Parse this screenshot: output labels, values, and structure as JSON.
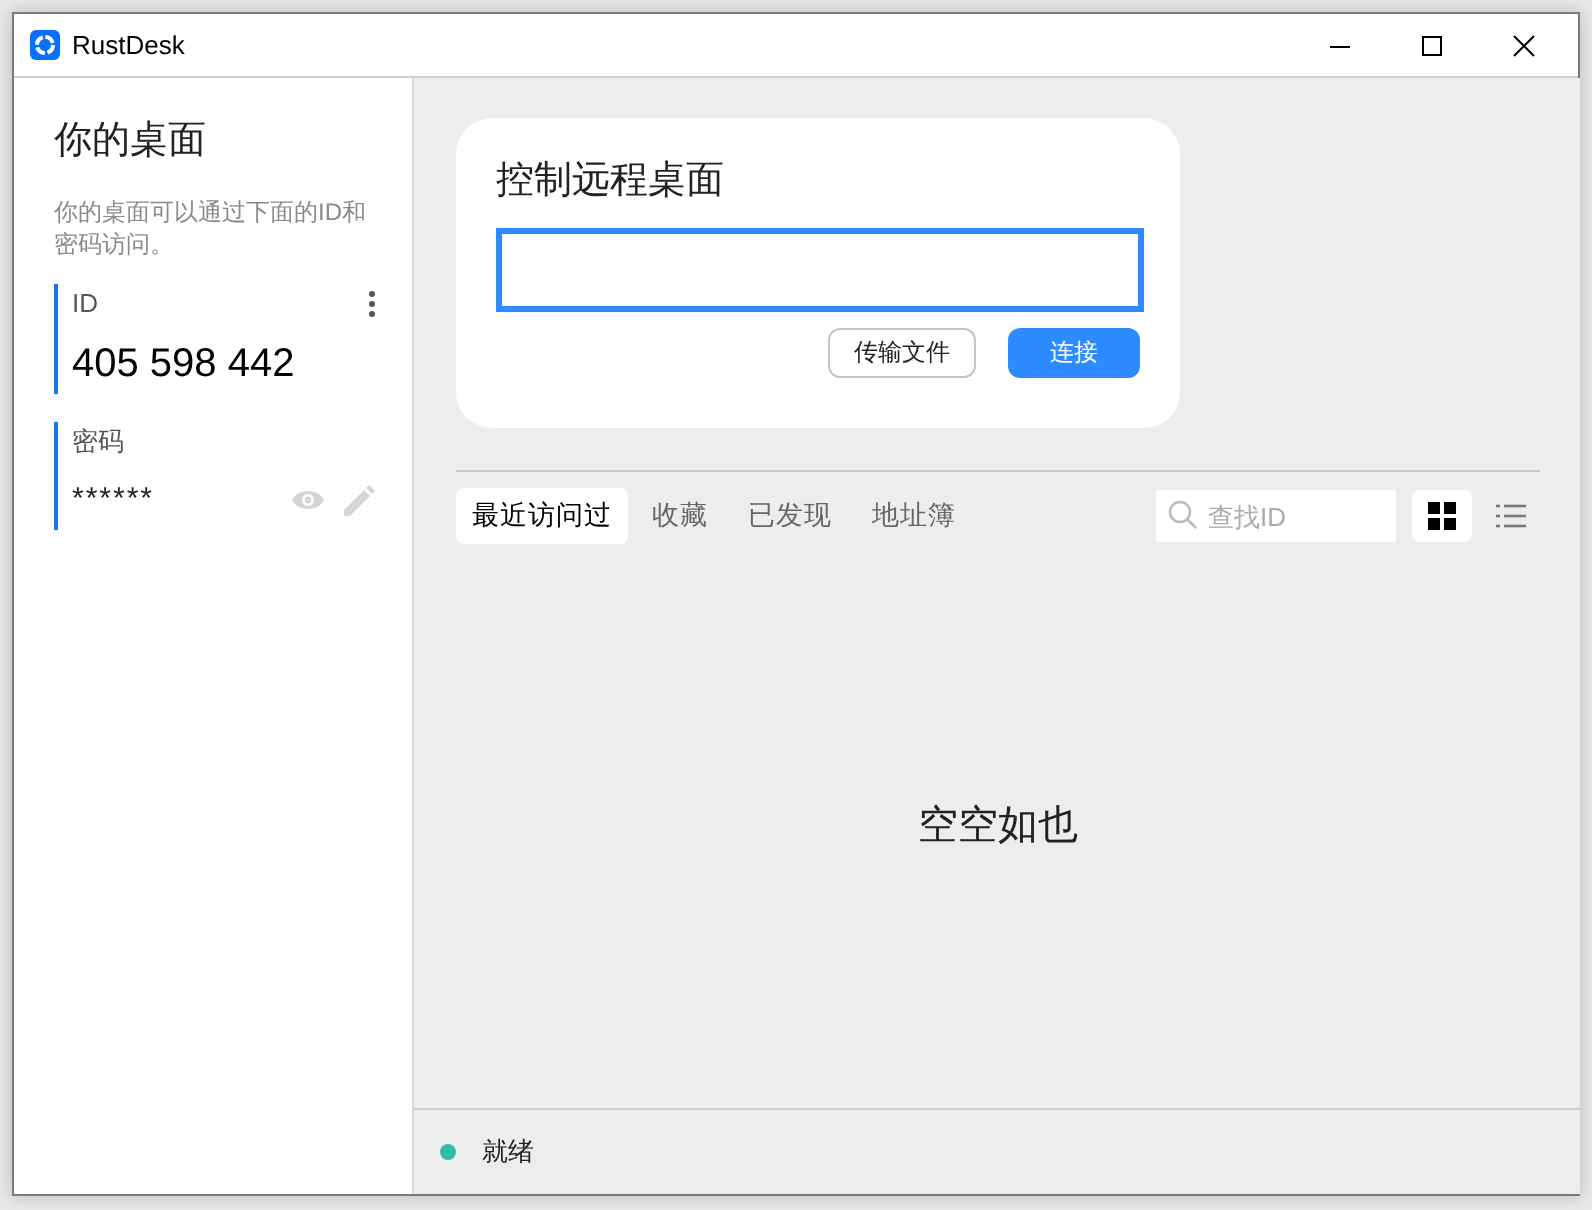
{
  "window": {
    "title": "RustDesk"
  },
  "sidebar": {
    "title": "你的桌面",
    "description": "你的桌面可以通过下面的ID和密码访问。",
    "id": {
      "label": "ID",
      "value": "405 598 442"
    },
    "password": {
      "label": "密码",
      "value": "******"
    }
  },
  "remote": {
    "title": "控制远程桌面",
    "buttons": [
      {
        "label": "传输文件",
        "kind": "outline"
      },
      {
        "label": "连接",
        "kind": "primary"
      }
    ]
  },
  "peers": {
    "tabs": [
      {
        "label": "最近访问过",
        "selected": true
      },
      {
        "label": "收藏",
        "selected": false
      },
      {
        "label": "已发现",
        "selected": false
      },
      {
        "label": "地址簿",
        "selected": false
      }
    ],
    "search": {
      "placeholder": "查找ID"
    },
    "views": [
      {
        "kind": "grid",
        "selected": true
      },
      {
        "kind": "list",
        "selected": false
      }
    ],
    "empty_text": "空空如也"
  },
  "status": {
    "text": "就绪"
  }
}
